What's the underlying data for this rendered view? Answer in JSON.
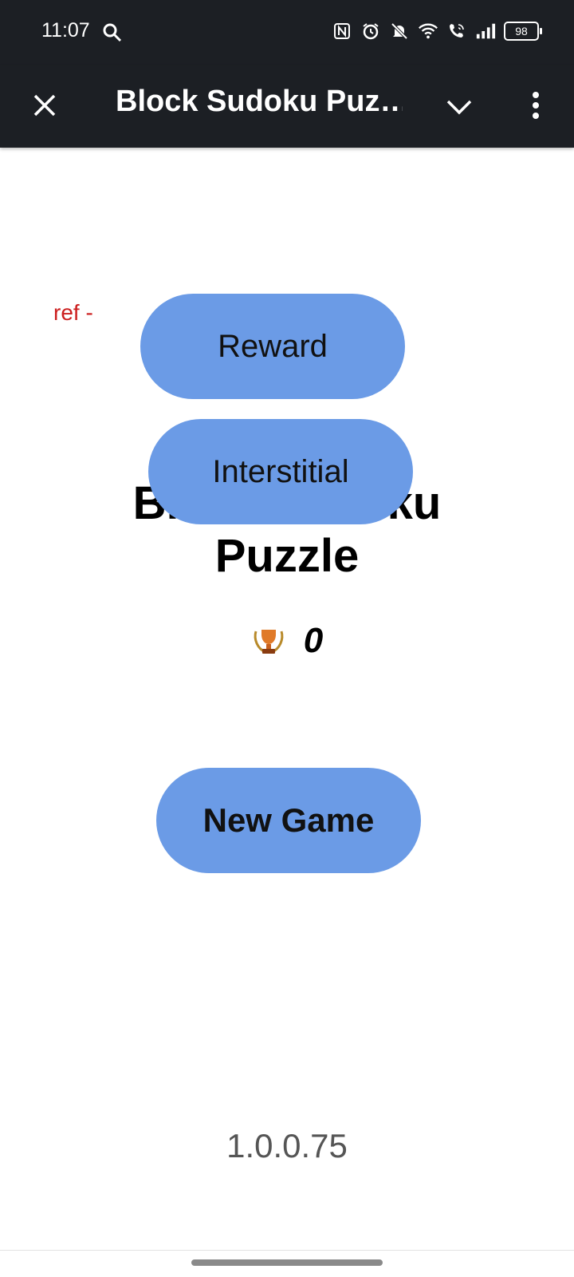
{
  "status_bar": {
    "time": "11:07",
    "battery": "98",
    "icons": [
      "search-icon",
      "nfc-icon",
      "alarm-icon",
      "mute-icon",
      "wifi-icon",
      "wifi-calling-icon",
      "signal-icon",
      "battery-icon"
    ]
  },
  "app_bar": {
    "title": "Block Sudoku Puz…",
    "close_icon": "close-icon",
    "chevron_icon": "chevron-down-icon",
    "more_icon": "more-vert-icon"
  },
  "main": {
    "ref_label": "ref -",
    "reward_button": "Reward",
    "interstitial_button": "Interstitial",
    "game_title": "Block Sudoku Puzzle",
    "score": "0",
    "new_game_button": "New Game",
    "version": "1.0.0.75"
  },
  "colors": {
    "status_bar_bg": "#1c1f24",
    "button_bg": "#6b9be6",
    "ref_label": "#cc1e1e"
  }
}
